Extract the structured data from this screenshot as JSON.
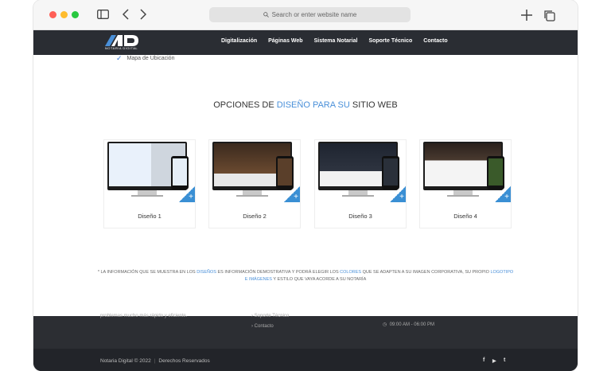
{
  "browser": {
    "url_placeholder": "Search or enter website name",
    "icons": [
      "sidebar-icon",
      "back-icon",
      "forward-icon",
      "new-tab-icon",
      "tabs-icon",
      "search-icon"
    ]
  },
  "nav": {
    "logo_text": "NOTARIA DIGITAL",
    "items": [
      "Digitalización",
      "Páginas Web",
      "Sistema Notarial",
      "Soporte Técnico",
      "Contacto"
    ]
  },
  "feature": {
    "label": "Mapa de Ubicación"
  },
  "section": {
    "title_pre": "OPCIONES DE ",
    "title_accent": "DISEÑO PARA SU",
    "title_post": " SITIO WEB"
  },
  "designs": [
    {
      "label": "Diseño 1"
    },
    {
      "label": "Diseño 2"
    },
    {
      "label": "Diseño 3"
    },
    {
      "label": "Diseño 4"
    }
  ],
  "disclaimer": {
    "p1": "* LA INFORMACIÓN QUE SE MUESTRA EN LOS ",
    "l1": "DISEÑOS",
    "p2": " ES INFORMACIÓN DEMOSTRATIVA Y PODRÁ ELEGIR LOS ",
    "l2": "COLORES",
    "p3": " QUE SE ADAPTEN A SU IMAGEN CORPORATIVA, SU PROPIO ",
    "l3": "LOGOTIPO E IMÁGENES",
    "p4": " Y ESTILO QUE VAYA ACORDE A SU NOTARÍA"
  },
  "footer": {
    "left_partial": "problemas mucho más rápido y eficiente.",
    "link_partial": "Soporte Técnico",
    "link_contact": "Contacto",
    "hours": "09:00 AM - 06:00 PM",
    "copyright": "Notaria Digital © 2022",
    "separator": "|",
    "rights": "Derechos Reservados",
    "social": [
      "f",
      "▶",
      "t"
    ]
  },
  "colors": {
    "accent": "#4a90d9",
    "nav_bg": "#2a2d33",
    "footer_bg": "#2c2e33"
  }
}
